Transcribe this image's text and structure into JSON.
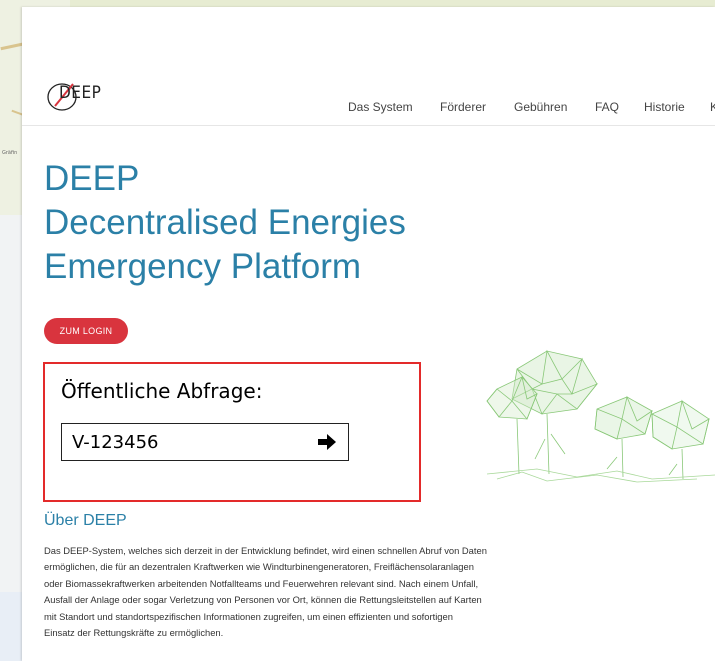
{
  "map": {
    "place_label": "Gräfin"
  },
  "header": {
    "logo_text": "DEEP",
    "nav": [
      "Das System",
      "Förderer",
      "Gebühren",
      "FAQ",
      "Historie",
      "K"
    ]
  },
  "hero": {
    "title_lines": [
      "DEEP",
      "Decentralised Energies",
      "Emergency Platform"
    ],
    "login_label": "ZUM LOGIN"
  },
  "query": {
    "label": "Öffentliche Abfrage:",
    "value": "V-123456",
    "submit_icon": "arrow-right-icon"
  },
  "about": {
    "heading": "Über DEEP",
    "lines": [
      "Das DEEP-System, welches sich derzeit in der Entwicklung befindet, wird einen schnellen Abruf von Daten",
      "ermöglichen, die für an dezentralen Kraftwerken wie Windturbinengeneratoren, Freiflächensolaranlagen",
      "oder Biomassekraftwerken arbeitenden Notfallteams und Feuerwehren relevant sind. Nach einem Unfall,",
      "Ausfall der Anlage oder sogar Verletzung von Personen vor Ort, können die Rettungsleitstellen auf Karten",
      "mit Standort und standortspezifischen Informationen zugreifen, um einen effizienten und sofortigen",
      "Einsatz der Rettungskräfte zu ermöglichen."
    ]
  },
  "colors": {
    "brand_blue": "#2b80a7",
    "login_red": "#d9343e",
    "highlight_red": "#e32a2a",
    "tree_green": "#7dc26a"
  }
}
